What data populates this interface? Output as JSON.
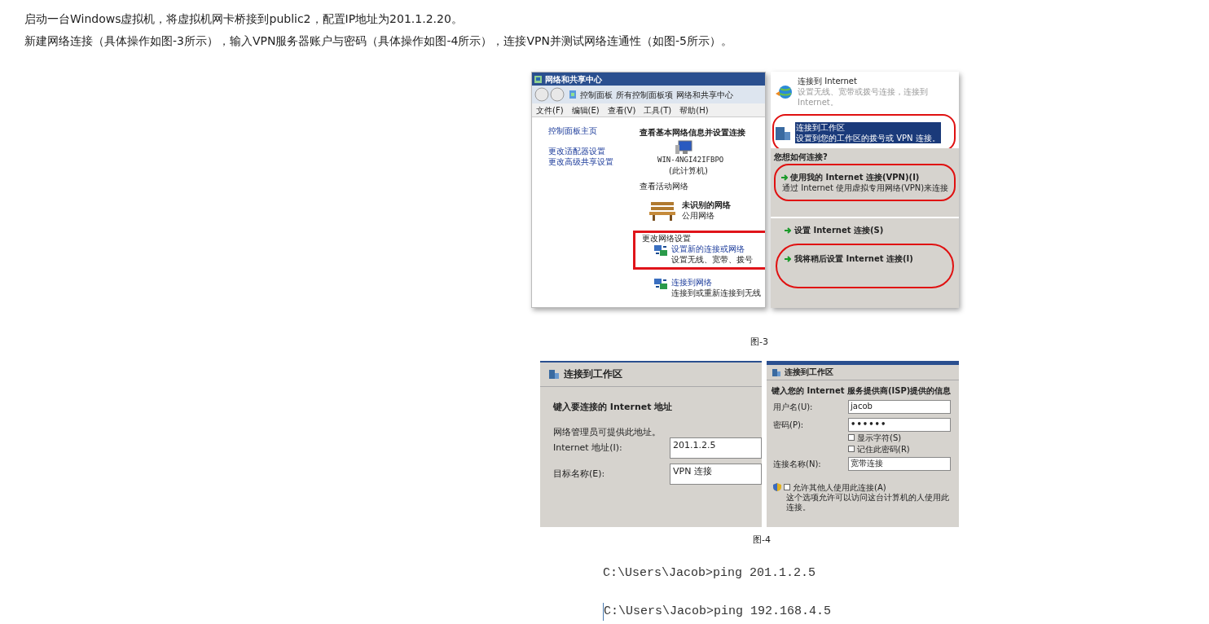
{
  "paragraphs": [
    "启动一台Windows虚拟机，将虚拟机网卡桥接到public2，配置IP地址为201.1.2.20。",
    "新建网络连接（具体操作如图-3所示），输入VPN服务器账户与密码（具体操作如图-4所示），连接VPN并测试网络连通性（如图-5所示）。"
  ],
  "figure_3": {
    "network_center": {
      "title": "网络和共享中心",
      "breadcrumb": [
        "控制面板",
        "所有控制面板项",
        "网络和共享中心"
      ],
      "menu": [
        "文件(F)",
        "编辑(E)",
        "查看(V)",
        "工具(T)",
        "帮助(H)"
      ],
      "sidebar_links": [
        "控制面板主页",
        "更改适配器设置",
        "更改高级共享设置"
      ],
      "heading": "查看基本网络信息并设置连接",
      "computer_name": "WIN-4NGI42IFBPO",
      "computer_note": "(此计算机)",
      "active_networks_label": "查看活动网络",
      "network_name": "未识别的网络",
      "network_type": "公用网络",
      "change_settings_label": "更改网络设置",
      "tasks": [
        {
          "title": "设置新的连接或网络",
          "description": "设置无线、宽带、拨号",
          "highlighted": true
        },
        {
          "title": "连接到网络",
          "description": "连接到或重新连接到无线",
          "highlighted": false
        }
      ]
    },
    "connection_options": [
      {
        "title": "连接到 Internet",
        "description": "设置无线、宽带或拨号连接，连接到 Internet。",
        "selected": false,
        "circled": false
      },
      {
        "title": "连接到工作区",
        "description": "设置到您的工作区的拨号或 VPN 连接。",
        "selected": true,
        "circled": true
      }
    ],
    "how_connect": {
      "question": "您想如何连接?",
      "options": [
        {
          "title": "使用我的 Internet 连接(VPN)(I)",
          "description": "通过 Internet 使用虚拟专用网络(VPN)来连接",
          "circled": true
        }
      ]
    },
    "internet_setup": [
      {
        "label": "设置 Internet 连接(S)",
        "circled": false
      },
      {
        "label": "我将稍后设置 Internet 连接(I)",
        "circled": true
      }
    ],
    "caption": "图-3"
  },
  "figure_4": {
    "address_step": {
      "title": "连接到工作区",
      "heading": "键入要连接的 Internet 地址",
      "note": "网络管理员可提供此地址。",
      "fields": [
        {
          "label": "Internet 地址(I):",
          "value": "201.1.2.5"
        },
        {
          "label": "目标名称(E):",
          "value": "VPN 连接"
        }
      ]
    },
    "credentials_step": {
      "title": "连接到工作区",
      "heading": "键入您的 Internet 服务提供商(ISP)提供的信息",
      "fields": [
        {
          "label": "用户名(U):",
          "value": "jacob",
          "kind": "text"
        },
        {
          "label": "密码(P):",
          "value": "••••••",
          "kind": "password"
        }
      ],
      "options": [
        {
          "label": "显示字符(S)",
          "checked": false
        },
        {
          "label": "记住此密码(R)",
          "checked": false
        }
      ],
      "connection_name": {
        "label": "连接名称(N):",
        "value": "宽带连接"
      },
      "allow_others": {
        "label": "允许其他人使用此连接(A)",
        "description": "这个选项允许可以访问这台计算机的人使用此连接。",
        "checked": false
      }
    },
    "caption": "图-4"
  },
  "commands": [
    "C:\\Users\\Jacob>ping 201.1.2.5",
    "C:\\Users\\Jacob>ping 192.168.4.5"
  ]
}
